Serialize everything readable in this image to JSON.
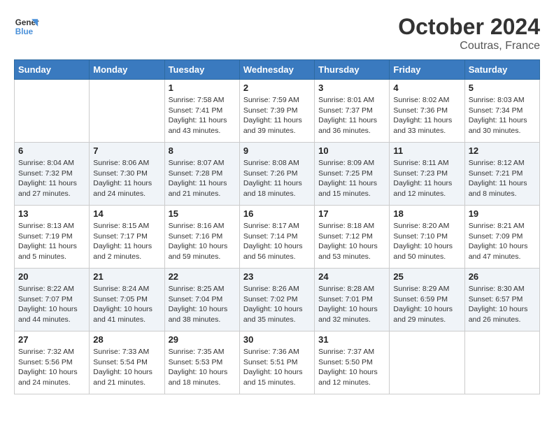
{
  "logo": {
    "line1": "General",
    "line2": "Blue"
  },
  "title": "October 2024",
  "subtitle": "Coutras, France",
  "header_days": [
    "Sunday",
    "Monday",
    "Tuesday",
    "Wednesday",
    "Thursday",
    "Friday",
    "Saturday"
  ],
  "weeks": [
    [
      {
        "day": "",
        "info": ""
      },
      {
        "day": "",
        "info": ""
      },
      {
        "day": "1",
        "info": "Sunrise: 7:58 AM\nSunset: 7:41 PM\nDaylight: 11 hours and 43 minutes."
      },
      {
        "day": "2",
        "info": "Sunrise: 7:59 AM\nSunset: 7:39 PM\nDaylight: 11 hours and 39 minutes."
      },
      {
        "day": "3",
        "info": "Sunrise: 8:01 AM\nSunset: 7:37 PM\nDaylight: 11 hours and 36 minutes."
      },
      {
        "day": "4",
        "info": "Sunrise: 8:02 AM\nSunset: 7:36 PM\nDaylight: 11 hours and 33 minutes."
      },
      {
        "day": "5",
        "info": "Sunrise: 8:03 AM\nSunset: 7:34 PM\nDaylight: 11 hours and 30 minutes."
      }
    ],
    [
      {
        "day": "6",
        "info": "Sunrise: 8:04 AM\nSunset: 7:32 PM\nDaylight: 11 hours and 27 minutes."
      },
      {
        "day": "7",
        "info": "Sunrise: 8:06 AM\nSunset: 7:30 PM\nDaylight: 11 hours and 24 minutes."
      },
      {
        "day": "8",
        "info": "Sunrise: 8:07 AM\nSunset: 7:28 PM\nDaylight: 11 hours and 21 minutes."
      },
      {
        "day": "9",
        "info": "Sunrise: 8:08 AM\nSunset: 7:26 PM\nDaylight: 11 hours and 18 minutes."
      },
      {
        "day": "10",
        "info": "Sunrise: 8:09 AM\nSunset: 7:25 PM\nDaylight: 11 hours and 15 minutes."
      },
      {
        "day": "11",
        "info": "Sunrise: 8:11 AM\nSunset: 7:23 PM\nDaylight: 11 hours and 12 minutes."
      },
      {
        "day": "12",
        "info": "Sunrise: 8:12 AM\nSunset: 7:21 PM\nDaylight: 11 hours and 8 minutes."
      }
    ],
    [
      {
        "day": "13",
        "info": "Sunrise: 8:13 AM\nSunset: 7:19 PM\nDaylight: 11 hours and 5 minutes."
      },
      {
        "day": "14",
        "info": "Sunrise: 8:15 AM\nSunset: 7:17 PM\nDaylight: 11 hours and 2 minutes."
      },
      {
        "day": "15",
        "info": "Sunrise: 8:16 AM\nSunset: 7:16 PM\nDaylight: 10 hours and 59 minutes."
      },
      {
        "day": "16",
        "info": "Sunrise: 8:17 AM\nSunset: 7:14 PM\nDaylight: 10 hours and 56 minutes."
      },
      {
        "day": "17",
        "info": "Sunrise: 8:18 AM\nSunset: 7:12 PM\nDaylight: 10 hours and 53 minutes."
      },
      {
        "day": "18",
        "info": "Sunrise: 8:20 AM\nSunset: 7:10 PM\nDaylight: 10 hours and 50 minutes."
      },
      {
        "day": "19",
        "info": "Sunrise: 8:21 AM\nSunset: 7:09 PM\nDaylight: 10 hours and 47 minutes."
      }
    ],
    [
      {
        "day": "20",
        "info": "Sunrise: 8:22 AM\nSunset: 7:07 PM\nDaylight: 10 hours and 44 minutes."
      },
      {
        "day": "21",
        "info": "Sunrise: 8:24 AM\nSunset: 7:05 PM\nDaylight: 10 hours and 41 minutes."
      },
      {
        "day": "22",
        "info": "Sunrise: 8:25 AM\nSunset: 7:04 PM\nDaylight: 10 hours and 38 minutes."
      },
      {
        "day": "23",
        "info": "Sunrise: 8:26 AM\nSunset: 7:02 PM\nDaylight: 10 hours and 35 minutes."
      },
      {
        "day": "24",
        "info": "Sunrise: 8:28 AM\nSunset: 7:01 PM\nDaylight: 10 hours and 32 minutes."
      },
      {
        "day": "25",
        "info": "Sunrise: 8:29 AM\nSunset: 6:59 PM\nDaylight: 10 hours and 29 minutes."
      },
      {
        "day": "26",
        "info": "Sunrise: 8:30 AM\nSunset: 6:57 PM\nDaylight: 10 hours and 26 minutes."
      }
    ],
    [
      {
        "day": "27",
        "info": "Sunrise: 7:32 AM\nSunset: 5:56 PM\nDaylight: 10 hours and 24 minutes."
      },
      {
        "day": "28",
        "info": "Sunrise: 7:33 AM\nSunset: 5:54 PM\nDaylight: 10 hours and 21 minutes."
      },
      {
        "day": "29",
        "info": "Sunrise: 7:35 AM\nSunset: 5:53 PM\nDaylight: 10 hours and 18 minutes."
      },
      {
        "day": "30",
        "info": "Sunrise: 7:36 AM\nSunset: 5:51 PM\nDaylight: 10 hours and 15 minutes."
      },
      {
        "day": "31",
        "info": "Sunrise: 7:37 AM\nSunset: 5:50 PM\nDaylight: 10 hours and 12 minutes."
      },
      {
        "day": "",
        "info": ""
      },
      {
        "day": "",
        "info": ""
      }
    ]
  ]
}
